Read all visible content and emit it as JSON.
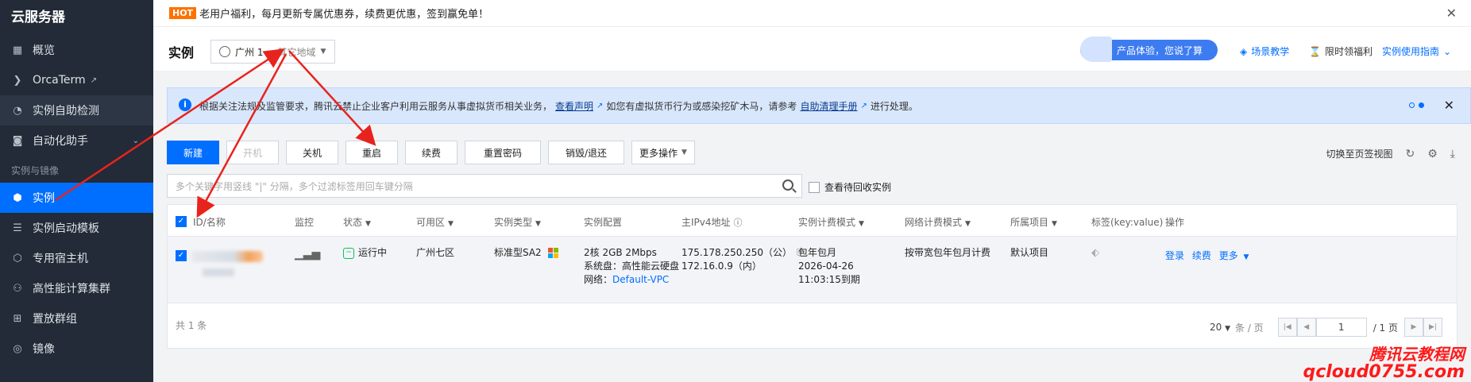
{
  "sidebar": {
    "title": "云服务器",
    "items": [
      {
        "label": "概览",
        "icon": "grid-icon"
      },
      {
        "label": "OrcaTerm",
        "icon": "terminal-icon"
      },
      {
        "label": "实例自助检测",
        "icon": "speedometer-icon"
      },
      {
        "label": "自动化助手",
        "icon": "robot-icon"
      }
    ],
    "group_label": "实例与镜像",
    "group_items": [
      {
        "label": "实例",
        "icon": "cube-icon"
      },
      {
        "label": "实例启动模板",
        "icon": "template-icon"
      },
      {
        "label": "专用宿主机",
        "icon": "host-icon"
      },
      {
        "label": "高性能计算集群",
        "icon": "cluster-icon"
      },
      {
        "label": "置放群组",
        "icon": "placement-icon"
      },
      {
        "label": "镜像",
        "icon": "disc-icon"
      }
    ]
  },
  "notice": {
    "badge": "HOT",
    "text": "老用户福利，每月更新专属优惠券，续费更优惠，签到赢免单！"
  },
  "header": {
    "title": "实例",
    "region": "广州 1",
    "other_region": "其它地域",
    "promo": "产品体验，您说了算",
    "links": [
      "场景教学",
      "限时领福利",
      "实例使用指南"
    ]
  },
  "banner": {
    "text_a": "根据关注法规及监管要求，腾讯云禁止企业客户利用云服务从事虚拟货币相关业务，",
    "link_a": "查看声明",
    "text_b": "如您有虚拟货币行为或感染挖矿木马，请参考",
    "link_b": "自助清理手册",
    "text_c": "进行处理。"
  },
  "toolbar": {
    "new": "新建",
    "start": "开机",
    "stop": "关机",
    "restart": "重启",
    "renew": "续费",
    "reset_pwd": "重置密码",
    "destroy": "销毁/退还",
    "more": "更多操作",
    "switch_view": "切换至页签视图"
  },
  "search": {
    "placeholder": "多个关键字用竖线 \"|\" 分隔，多个过滤标签用回车键分隔",
    "recycle": "查看待回收实例"
  },
  "table": {
    "headers": [
      "ID/名称",
      "监控",
      "状态",
      "可用区",
      "实例类型",
      "实例配置",
      "主IPv4地址",
      "实例计费模式",
      "网络计费模式",
      "所属项目",
      "标签(key:value)",
      "操作"
    ],
    "row": {
      "status": "运行中",
      "zone": "广州七区",
      "type": "标准型SA2",
      "config1": "2核 2GB 2Mbps",
      "config2": "系统盘：高性能云硬盘",
      "config3_label": "网络：",
      "config3_link": "Default-VPC",
      "ip_public": "175.178.250.250（公）",
      "ip_private": "172.16.0.9（内）",
      "billing1": "包年包月",
      "billing2": "2026-04-26",
      "billing3": "11:03:15到期",
      "net_billing": "按带宽包年包月计费",
      "project": "默认项目",
      "actions": [
        "登录",
        "续费",
        "更多"
      ]
    },
    "total": "共 1 条",
    "page_size": "20",
    "per_page": "条 / 页",
    "page": "1",
    "pages": "/ 1 页"
  },
  "watermark": {
    "line1": "腾讯云教程网",
    "line2": "qcloud0755.com"
  },
  "colors": {
    "primary": "#006eff",
    "sidebar": "#222b37",
    "annotation": "#e8231d",
    "watermark": "#ff1a1a"
  }
}
